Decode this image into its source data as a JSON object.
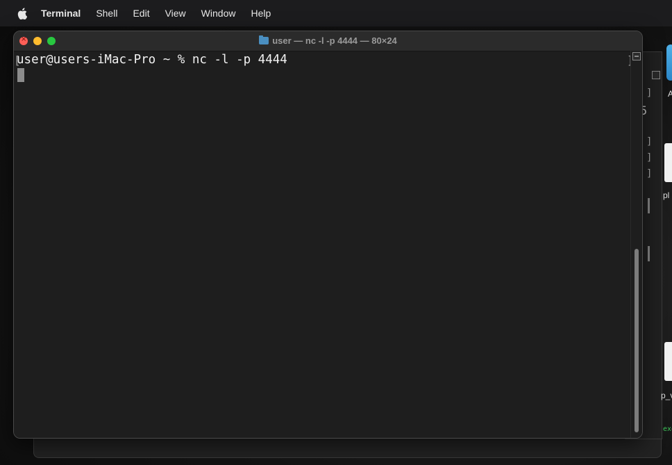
{
  "menubar": {
    "apple_icon": "apple-logo-icon",
    "app_name": "Terminal",
    "items": [
      "Shell",
      "Edit",
      "View",
      "Window",
      "Help"
    ]
  },
  "terminal": {
    "title": "user — nc -l -p 4444 — 80×24",
    "prompt_line": "user@users-iMac-Pro ~ % nc -l -p 4444",
    "folder_icon": "folder-icon"
  },
  "background_window": {
    "visible_digit": "5"
  },
  "desktop": {
    "labels": [
      "A",
      "pl",
      "p_v"
    ],
    "terminal_snippet": "exe"
  },
  "colors": {
    "close": "#fe5f57",
    "minimize": "#febc2e",
    "maximize": "#28c840",
    "terminal_bg": "#1e1e1e",
    "text": "#f2f2f2"
  }
}
